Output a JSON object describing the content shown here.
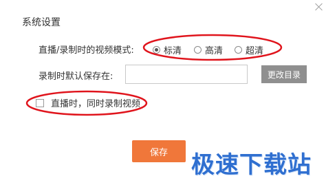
{
  "dialog": {
    "title": "系统设置"
  },
  "mode": {
    "label": "直播/录制时的视频模式:",
    "options": [
      "标清",
      "高清",
      "超清"
    ],
    "selected": "标清"
  },
  "save_path": {
    "label": "录制时默认保存在:",
    "value": "",
    "change_button": "更改目录"
  },
  "record_while_live": {
    "label": "直播时，同时录制视频",
    "checked": false
  },
  "actions": {
    "save_label": "保存"
  },
  "watermark": {
    "text": "极速下载站"
  },
  "colors": {
    "accent": "#f0773a",
    "highlight_ring": "#e0141c",
    "secondary_button": "#8f8f8f",
    "watermark": "#2f6fd0"
  }
}
